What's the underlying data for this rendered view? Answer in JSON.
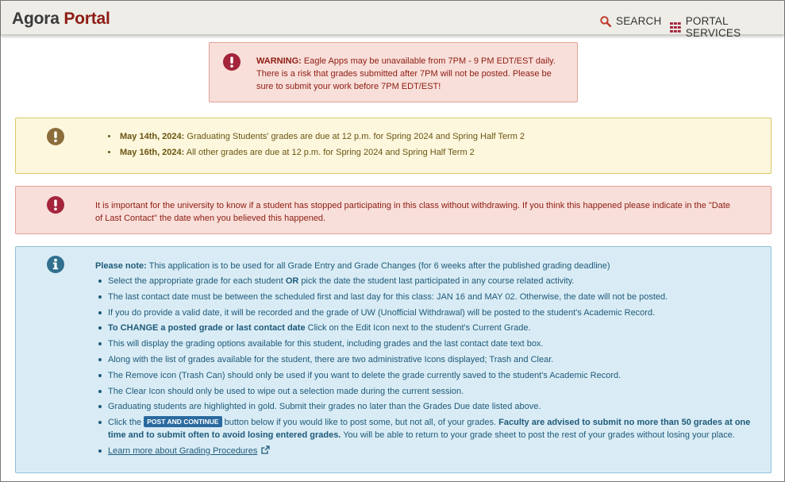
{
  "header": {
    "brand_main": "Agora",
    "brand_accent": "Portal",
    "search_label": "SEARCH",
    "services_label": "PORTAL SERVICES"
  },
  "warning": {
    "label": "WARNING:",
    "line1": " Eagle Apps may be unavailable from 7PM - 9 PM EDT/EST daily.",
    "line2": "There is a risk that grades submitted after 7PM will not be posted. Please be",
    "line3": "sure to submit your work before 7PM EDT/EST!"
  },
  "deadlines": {
    "items": [
      {
        "date": "May 14th, 2024:",
        "text": " Graduating Students' grades are due at 12 p.m. for Spring 2024 and Spring Half Term 2"
      },
      {
        "date": "May 16th, 2024:",
        "text": " All other grades are due at 12 p.m. for Spring 2024 and Spring Half Term 2"
      }
    ]
  },
  "contact_notice": {
    "line1": "It is important for the university to know if a student has stopped participating in this class without withdrawing. If you think this happened please indicate in the \"Date",
    "line2": "of Last Contact\" the date when you believed this happened."
  },
  "note": {
    "intro_label": "Please note:",
    "intro_text": " This application is to be used for all Grade Entry and Grade Changes (for 6 weeks after the published grading deadline)",
    "b1_pre": "Select the appropriate grade for each student ",
    "b1_or": "OR",
    "b1_post": " pick the date the student last participated in any course related activity.",
    "b2": "The last contact date must be between the scheduled first and last day for this class: JAN 16 and MAY 02. Otherwise, the date will not be posted.",
    "b3": "If you do provide a valid date, it will be recorded and the grade of UW (Unofficial Withdrawal) will be posted to the student's Academic Record.",
    "b4_bold": "To CHANGE a posted grade or last contact date",
    "b4_text": " Click on the Edit Icon next to the student's Current Grade.",
    "b5": "This will display the grading options available for this student, including grades and the last contact date text box.",
    "b6": "Along with the list of grades available for the student, there are two administrative Icons displayed; Trash and Clear.",
    "b7": "The Remove icon (Trash Can) should only be used if you want to delete the grade currently saved to the student's Academic Record.",
    "b8": "The Clear Icon should only be used to wipe out a selection made during the current session.",
    "b9": "Graduating students are highlighted in gold. Submit their grades no later than the Grades Due date listed above.",
    "b10_pre": "Click the ",
    "b10_button": "POST AND CONTINUE",
    "b10_mid": " button below if you would like to post some, but not all, of your grades. ",
    "b10_bold": "Faculty are advised to submit no more than 50 grades at one time and to submit often to avoid losing entered grades.",
    "b10_post": " You will be able to return to your grade sheet to post the rest of your grades without losing your place.",
    "learn_more": "Learn more about Grading Procedures"
  },
  "colors": {
    "brand_accent": "#8c1c13",
    "search_icon": "#c0392b",
    "red_icon": "#a3243b",
    "yellow_icon": "#8a6d3b",
    "blue_icon": "#31708f"
  }
}
